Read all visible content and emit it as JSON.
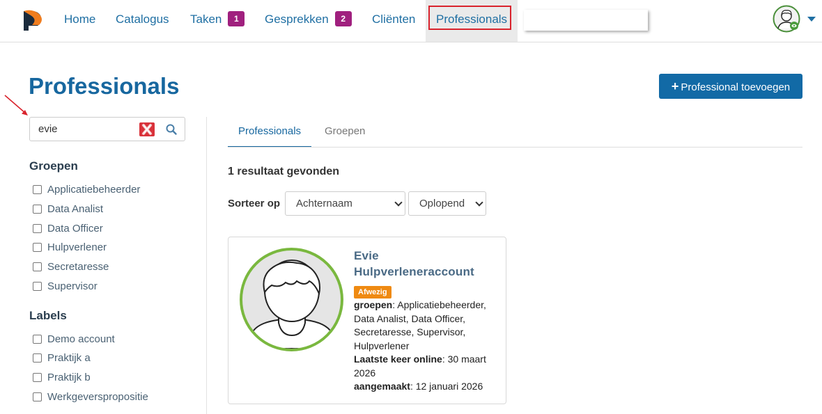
{
  "nav": {
    "items": [
      {
        "label": "Home"
      },
      {
        "label": "Catalogus"
      },
      {
        "label": "Taken",
        "badge": "1"
      },
      {
        "label": "Gesprekken",
        "badge": "2"
      },
      {
        "label": "Cliënten"
      },
      {
        "label": "Professionals"
      }
    ],
    "active": "Professionals",
    "search_value": ""
  },
  "page": {
    "title": "Professionals",
    "add_button": "Professional toevoegen"
  },
  "sidebar": {
    "search_value": "evie",
    "groups_title": "Groepen",
    "groups": [
      "Applicatiebeheerder",
      "Data Analist",
      "Data Officer",
      "Hulpverlener",
      "Secretaresse",
      "Supervisor"
    ],
    "labels_title": "Labels",
    "labels": [
      "Demo account",
      "Praktijk a",
      "Praktijk b",
      "Werkgeverspropositie"
    ]
  },
  "tabs": [
    "Professionals",
    "Groepen"
  ],
  "results": {
    "count_text": "1 resultaat gevonden",
    "sort_label": "Sorteer op",
    "sort_field": "Achternaam",
    "sort_order": "Oplopend"
  },
  "card": {
    "name": "Evie Hulpverleneraccount",
    "status": "Afwezig",
    "groups_label": "groepen",
    "groups_value": ": Applicatiebeheerder, Data Analist, Data Officer, Secretaresse, Supervisor, Hulpverlener",
    "last_online_label": "Laatste keer online",
    "last_online_value": ": 30 maart 2026",
    "created_label": "aangemaakt",
    "created_value": ": 12 januari 2026"
  },
  "colors": {
    "primary": "#17679f",
    "badge": "#a0207e",
    "status_absent": "#ef8a12",
    "avatar_ring": "#7ab83f",
    "annotation": "#d9232d"
  }
}
